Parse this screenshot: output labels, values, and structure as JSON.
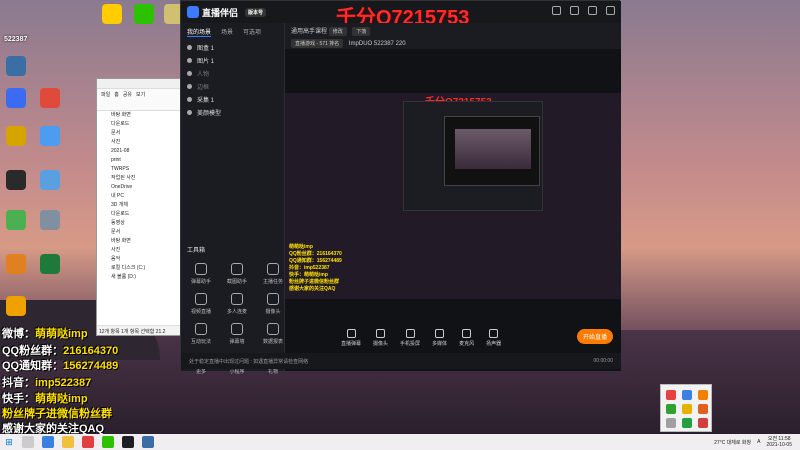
{
  "desktop": {
    "icons": [
      {
        "label": "",
        "color": "#3a6ea5"
      },
      {
        "label": "",
        "color": "#ffcc00"
      },
      {
        "label": "",
        "color": "#2dc100"
      },
      {
        "label": "",
        "color": "#3b6bf0"
      },
      {
        "label": "",
        "color": "#e04a3a"
      },
      {
        "label": "",
        "color": "#d6a400"
      },
      {
        "label": "",
        "color": "#4c9cf0"
      },
      {
        "label": "",
        "color": "#2a2a2a"
      },
      {
        "label": "",
        "color": "#5aa0e0"
      },
      {
        "label": "",
        "color": "#4caf50"
      },
      {
        "label": "",
        "color": "#8090a0"
      },
      {
        "label": "",
        "color": "#e08020"
      },
      {
        "label": "",
        "color": "#1d7a3a"
      },
      {
        "label": "",
        "color": "#f0a000"
      },
      {
        "label": "",
        "color": "#d0c070"
      }
    ]
  },
  "streamer_overlay": {
    "counter": "522387",
    "weibo_label": "微博：",
    "weibo_value": "萌萌哒imp",
    "fan_label": "QQ粉丝群：",
    "fan_value": "216164370",
    "notice_label": "QQ通知群：",
    "notice_value": "156274489",
    "douyin_label": "抖音：",
    "douyin_value": "imp522387",
    "kuaishou_label": "快手：",
    "kuaishou_value": "萌萌哒imp",
    "join_text": "粉丝牌子进微信粉丝群",
    "thanks_text": "感谢大家的关注QAQ"
  },
  "explorer": {
    "ribbon": [
      "파일",
      "홈",
      "공유",
      "보기"
    ],
    "items": [
      "바탕 화면",
      "다운로드",
      "문서",
      "사진",
      "2021-08",
      "print",
      "TWRPS",
      "작업된 사진",
      "OneDrive",
      "내 PC",
      "3D 개체",
      "다운로드",
      "동영상",
      "문서",
      "바탕 화면",
      "사진",
      "음악",
      "로컬 디스크 (C:)",
      "새 볼륨 (D:)"
    ],
    "status": "12개 항목   1개 항목 선택함 21.2"
  },
  "app": {
    "name": "直播伴侣",
    "version": "版本号",
    "watermark": "千分Q7215753",
    "left_tabs": [
      "我的场景",
      "场景",
      "可选项"
    ],
    "scenes": [
      {
        "name": "图盒 1",
        "dim": false
      },
      {
        "name": "图片 1",
        "dim": false
      },
      {
        "name": "人物",
        "dim": true
      },
      {
        "name": "边框",
        "dim": true
      },
      {
        "name": "采集 1",
        "dim": false
      },
      {
        "name": "美颜模型",
        "dim": false
      }
    ],
    "tools_title": "工具箱",
    "tools": [
      "弹幕助手",
      "截图助手",
      "主播任务",
      "视频直播",
      "多人连麦",
      "摄像头",
      "互动玩法",
      "弹幕墙",
      "数据报表",
      "更多",
      "小程序",
      "礼物"
    ],
    "right_header": {
      "title": "通用高手课程",
      "edit": "修改",
      "dropdown": "下落",
      "category": "直播游戏 - 571 排名",
      "room": "ImpDUO",
      "room_id": "522387",
      "viewers": "220"
    },
    "preview_watermark": "千分Q7215753",
    "preview_overlay": [
      "萌萌哒imp",
      "QQ粉丝群：216164370",
      "QQ通知群：156274489",
      "抖音：imp522387",
      "快手：萌萌哒imp",
      "粉丝牌子进微信粉丝群",
      "感谢大家的关注QAQ"
    ],
    "controls": [
      "直播弹幕",
      "摄像头",
      "手机投屏",
      "多媒体",
      "麦克风",
      "扬声器"
    ],
    "go_live": "开始直播",
    "status": "处于稳定直播中出现过问题 : 如遇直播异常请检查网络",
    "status_time": "00:00:00"
  },
  "tray_popup": {
    "colors": [
      "#e84040",
      "#3a80e0",
      "#f08000",
      "#30a030",
      "#e8b000",
      "#e06020",
      "#a0a0a0",
      "#20a040",
      "#d04040"
    ]
  },
  "taskbar": {
    "weather": "27°C 대체로 화창",
    "time": "오전 11:58",
    "date": "2021-10-05",
    "lang": "A"
  }
}
